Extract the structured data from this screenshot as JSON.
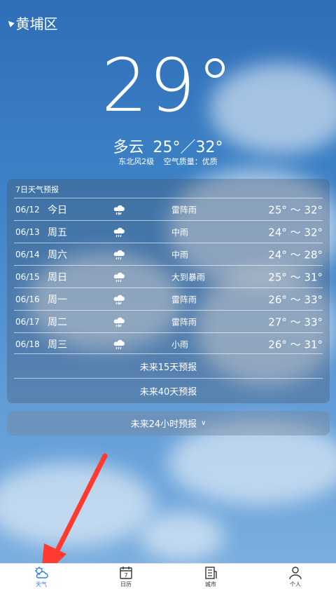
{
  "location": {
    "name": "黄埔区",
    "icon": "location-arrow-icon"
  },
  "current": {
    "temperature": "29°",
    "condition": "多云",
    "range": "25°／32°",
    "wind": "东北风2级",
    "air_quality": "空气质量：优质"
  },
  "forecast": {
    "title": "7日天气预报",
    "days": [
      {
        "date": "06/12",
        "day": "今日",
        "icon": "thunderstorm-icon",
        "condition": "雷阵雨",
        "temp": "25° ～ 32°"
      },
      {
        "date": "06/13",
        "day": "周五",
        "icon": "rain-icon",
        "condition": "中雨",
        "temp": "24° ～ 32°"
      },
      {
        "date": "06/14",
        "day": "周六",
        "icon": "rain-icon",
        "condition": "中雨",
        "temp": "24° ～ 28°"
      },
      {
        "date": "06/15",
        "day": "周日",
        "icon": "rain-icon",
        "condition": "大到暴雨",
        "temp": "25° ～ 31°"
      },
      {
        "date": "06/16",
        "day": "周一",
        "icon": "thunderstorm-icon",
        "condition": "雷阵雨",
        "temp": "26° ～ 33°"
      },
      {
        "date": "06/17",
        "day": "周二",
        "icon": "thunderstorm-icon",
        "condition": "雷阵雨",
        "temp": "27° ～ 33°"
      },
      {
        "date": "06/18",
        "day": "周三",
        "icon": "rain-icon",
        "condition": "小雨",
        "temp": "26° ～ 31°"
      }
    ],
    "link_15": "未来15天预报",
    "link_40": "未来40天预报"
  },
  "hourly_button": "未来24小时预报",
  "tabs": [
    {
      "label": "天气",
      "icon": "weather-icon",
      "active": true
    },
    {
      "label": "日历",
      "icon": "calendar-icon",
      "active": false
    },
    {
      "label": "城市",
      "icon": "city-icon",
      "active": false
    },
    {
      "label": "个人",
      "icon": "person-icon",
      "active": false
    }
  ],
  "calendar_day": "7",
  "colors": {
    "active_tab": "#2a7de1",
    "annotation_arrow": "#ff3b30"
  }
}
